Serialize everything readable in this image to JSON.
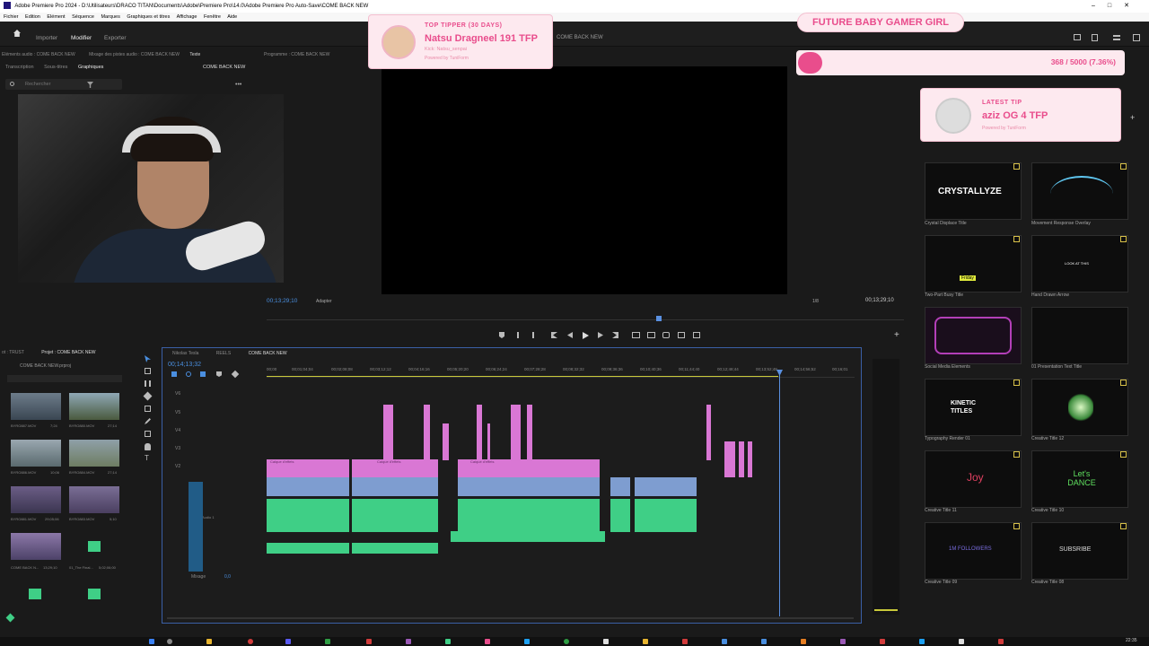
{
  "window": {
    "title": "Adobe Premiere Pro 2024 - D:\\Utilisateurs\\DRACO TITAN\\Documents\\Adobe\\Premiere Pro\\14.0\\Adobe Premiere Pro Auto-Save\\COME BACK NEW"
  },
  "menu": [
    "Fichier",
    "Edition",
    "Elément",
    "Séquence",
    "Marques",
    "Graphiques et titres",
    "Affichage",
    "Fenêtre",
    "Aide"
  ],
  "topnav": {
    "tabs": [
      "Importer",
      "Modifier",
      "Exporter"
    ],
    "active": "Modifier",
    "sequence_label": "COME BACK NEW"
  },
  "left_panel": {
    "header": "Eléments audio : COME BACK NEW",
    "mixer_header": "Mixage des pistes audio : COME BACK NEW",
    "text_tab": "Texte",
    "subtabs": [
      "Transcription",
      "Sous-titres",
      "Graphiques"
    ],
    "sequence": "COME BACK NEW",
    "search_placeholder": "Rechercher"
  },
  "program": {
    "header": "Programme : COME BACK NEW",
    "timecode": "00;13;29;10",
    "fit": "Adapter",
    "ratio": "1/8",
    "duration": "00;13;29;10"
  },
  "timeline": {
    "tabs": [
      "Nikolas Tesla",
      "REELS",
      "COME BACK NEW"
    ],
    "timecode": "00;14;13;32",
    "ruler": [
      "00;00",
      "00;01;04;04",
      "00;02;08;08",
      "00;03;12;12",
      "00;04;16;16",
      "00;05;20;20",
      "00;06;24;24",
      "00;07;28;28",
      "00;08;32;32",
      "00;09;36;36",
      "00;10;40;36",
      "00;11;44;40",
      "00;12;48;44",
      "00;13;52;48",
      "00;14;56;52",
      "00;16;01"
    ],
    "video_tracks": [
      "V6",
      "V5",
      "V4",
      "V3",
      "V2",
      "V1"
    ],
    "audio_tracks": [
      "A1",
      "A2",
      "A3",
      "A4"
    ],
    "audio_label": "Audio 1",
    "mix_label": "Mixage",
    "mix_value": "0,0",
    "clip_label": "Calque d'effets"
  },
  "project": {
    "header_left": "ot : TRUST",
    "header": "Projet : COME BACK NEW",
    "file": "COME BACK NEW.prproj",
    "items": [
      {
        "name": "BYRO887.MOV",
        "dur": "7;24"
      },
      {
        "name": "BYRO880.MOV",
        "dur": "27;14"
      },
      {
        "name": "BYRO886.MOV",
        "dur": "10;06"
      },
      {
        "name": "BYRO884.MOV",
        "dur": "27;14"
      },
      {
        "name": "BYRO881.MOV",
        "dur": "29;05;06"
      },
      {
        "name": "BYRO883.MOV",
        "dur": "5;10"
      },
      {
        "name": "COME BACK N...",
        "dur": "13;29;10"
      },
      {
        "name": "01_The Final...",
        "dur": "5;02;06;00"
      }
    ]
  },
  "overlays": {
    "tipper_title": "TOP TIPPER (30 DAYS)",
    "tipper_name": "Natsu Dragneel 191 TFP",
    "tipper_kick": "Kick: Natsu_senpai",
    "tipper_powered": "Powered by TuniForm",
    "goal_title": "FUTURE BABY GAMER GIRL",
    "goal_progress": "368 / 5000 (7.36%)",
    "goal_fraction": 0.0736,
    "latest_title": "LATEST TIP",
    "latest_name": "aziz OG 4 TFP",
    "latest_powered": "Powered by TuniForm"
  },
  "effects": [
    {
      "name": "Crystal Displace Title",
      "art": "CRYSTALLYZE"
    },
    {
      "name": "Movement Response Overlay",
      "art": ""
    },
    {
      "name": "Two-Part Busy Title",
      "art": "Friday"
    },
    {
      "name": "Hand Drawn Arrow",
      "art": "LOOK AT THIS"
    },
    {
      "name": "Social Media Elements",
      "art": ""
    },
    {
      "name": "01 Presentation Text Title",
      "art": ""
    },
    {
      "name": "Typography Render 01",
      "art": "KINETIC TITLES"
    },
    {
      "name": "Creative Title 12",
      "art": ""
    },
    {
      "name": "Creative Title 11",
      "art": "Joy"
    },
    {
      "name": "Creative Title 10",
      "art": "Let's DANCE"
    },
    {
      "name": "Creative Title 09",
      "art": "1M FOLLOWERS"
    },
    {
      "name": "Creative Title 08",
      "art": "SUBSRIBE"
    }
  ],
  "clock": "22:35"
}
